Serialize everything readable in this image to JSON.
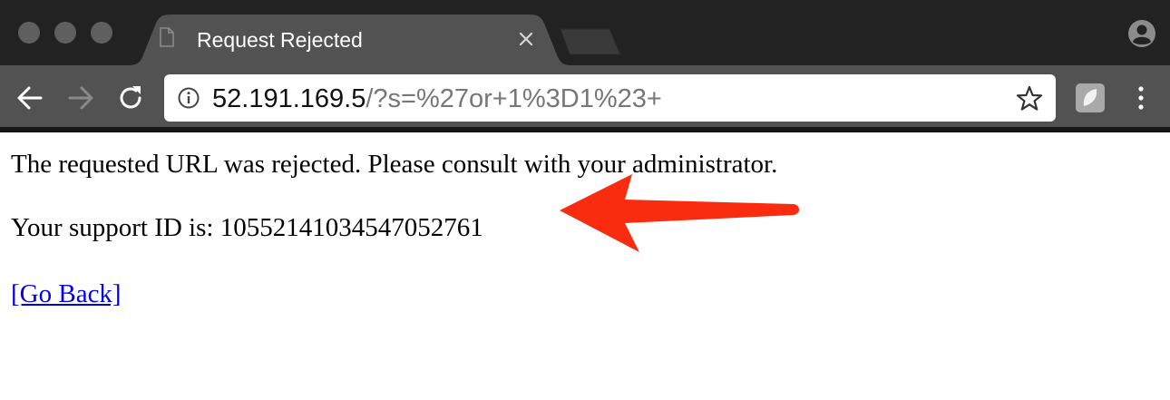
{
  "browser": {
    "tab": {
      "title": "Request Rejected"
    },
    "address_bar": {
      "url_host": "52.191.169.5",
      "url_path": "/?s=%27or+1%3D1%23+"
    },
    "icons": {
      "back": "arrow-left-icon",
      "forward": "arrow-right-icon",
      "reload": "reload-icon",
      "info": "info-icon",
      "bookmark": "star-icon",
      "extension": "extension-icon",
      "menu": "kebab-menu-icon",
      "profile": "profile-icon",
      "page": "page-icon",
      "close": "close-icon"
    }
  },
  "page": {
    "message": "The requested URL was rejected. Please consult with your administrator.",
    "support_id_line": "Your support ID is: 10552141034547052761",
    "go_back_link": "[Go Back]"
  },
  "annotation": {
    "arrow_color": "#fa2c10"
  }
}
